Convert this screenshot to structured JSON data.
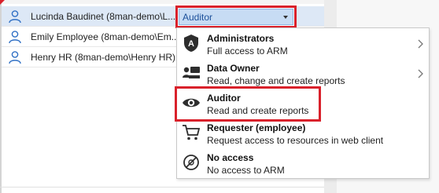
{
  "users": [
    {
      "name": "Lucinda Baudinet (8man-demo\\L...",
      "selected": true
    },
    {
      "name": "Emily Employee (8man-demo\\Em...",
      "selected": false
    },
    {
      "name": "Henry HR (8man-demo\\Henry HR)",
      "selected": false
    }
  ],
  "role_select": {
    "value": "Auditor"
  },
  "dropdown": {
    "options": [
      {
        "title": "Administrators",
        "description": "Full access to ARM",
        "icon": "admin-shield-icon",
        "has_submenu": true
      },
      {
        "title": "Data Owner",
        "description": "Read, change and create reports",
        "icon": "data-owner-icon",
        "has_submenu": true
      },
      {
        "title": "Auditor",
        "description": "Read and create reports",
        "icon": "eye-icon",
        "has_submenu": false
      },
      {
        "title": "Requester (employee)",
        "description": "Request access to resources in web client",
        "icon": "cart-icon",
        "has_submenu": false
      },
      {
        "title": "No access",
        "description": "No access to ARM",
        "icon": "no-access-icon",
        "has_submenu": false
      }
    ]
  },
  "colors": {
    "accent_red": "#d9212b",
    "selection_blue": "#c7dcf4",
    "user_icon_blue": "#2f6fc4"
  }
}
